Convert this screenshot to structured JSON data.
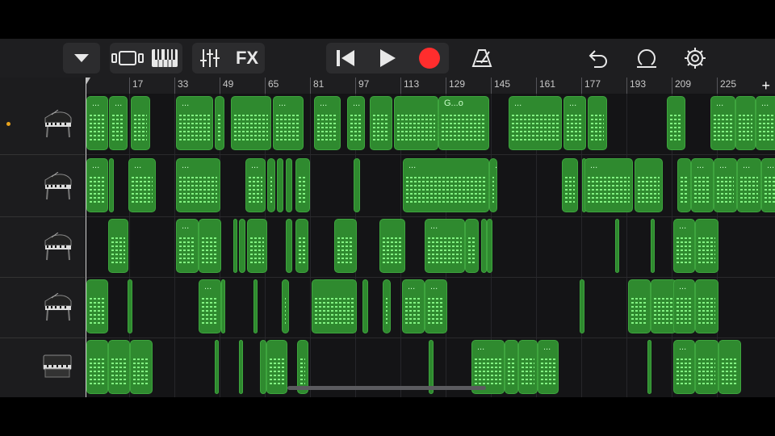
{
  "toolbar": {
    "buttons": [
      {
        "name": "tracks-dropdown-button",
        "icon": "triangle-down-icon"
      },
      {
        "name": "view-toggle-button",
        "icon": "tracks-view-icon"
      },
      {
        "name": "instrument-view-button",
        "icon": "keyboard-icon"
      },
      {
        "name": "mixer-button",
        "icon": "sliders-icon"
      },
      {
        "name": "fx-button",
        "label": "FX"
      },
      {
        "name": "go-to-start-button",
        "icon": "skip-back-icon"
      },
      {
        "name": "play-button",
        "icon": "play-icon"
      },
      {
        "name": "record-button",
        "icon": "record-icon",
        "color": "#ff2d2d"
      },
      {
        "name": "metronome-button",
        "icon": "metronome-icon"
      },
      {
        "name": "undo-button",
        "icon": "undo-icon"
      },
      {
        "name": "loop-browser-button",
        "icon": "loop-icon"
      },
      {
        "name": "settings-button",
        "icon": "gear-icon"
      }
    ],
    "fx_label": "FX"
  },
  "ruler": {
    "bars": [
      "17",
      "33",
      "49",
      "65",
      "81",
      "97",
      "113",
      "129",
      "145",
      "161",
      "177",
      "193",
      "209",
      "225"
    ],
    "add_label": "+"
  },
  "tracks": [
    {
      "instrument": "grand-piano-icon",
      "selected": true,
      "regions": [
        [
          "...",
          1,
          28
        ],
        [
          "...",
          29,
          52
        ],
        [
          "",
          56,
          80
        ],
        [
          "...",
          112,
          158
        ],
        [
          "",
          160,
          172
        ],
        [
          "",
          180,
          230
        ],
        [
          "...",
          232,
          270
        ],
        [
          "...",
          283,
          316
        ],
        [
          "...",
          324,
          346
        ],
        [
          "",
          352,
          380
        ],
        [
          "",
          382,
          437
        ],
        [
          "G...o",
          437,
          500
        ],
        [
          "...",
          524,
          590
        ],
        [
          "...",
          592,
          620
        ],
        [
          "",
          622,
          646
        ],
        [
          "",
          720,
          743
        ],
        [
          "...",
          774,
          805
        ],
        [
          "",
          805,
          830
        ],
        [
          "...",
          830,
          862
        ],
        [
          "",
          862,
          890
        ],
        [
          "...",
          890,
          918
        ],
        [
          "",
          918,
          945
        ]
      ]
    },
    {
      "instrument": "grand-piano-icon",
      "selected": false,
      "regions": [
        [
          "...",
          1,
          28
        ],
        [
          "",
          29,
          35
        ],
        [
          "...",
          53,
          87
        ],
        [
          "...",
          112,
          167
        ],
        [
          "...",
          198,
          223
        ],
        [
          "",
          225,
          235
        ],
        [
          "",
          237,
          245
        ],
        [
          "",
          248,
          256
        ],
        [
          "",
          260,
          278
        ],
        [
          "",
          332,
          340
        ],
        [
          "...",
          393,
          500
        ],
        [
          "...",
          500,
          510
        ],
        [
          "",
          590,
          610
        ],
        [
          "",
          615,
          620
        ],
        [
          "...",
          618,
          678
        ],
        [
          "",
          680,
          715
        ],
        [
          "",
          733,
          750
        ],
        [
          "...",
          750,
          778
        ],
        [
          "...",
          778,
          807
        ],
        [
          "...",
          807,
          837
        ],
        [
          "...",
          837,
          862
        ],
        [
          "...",
          862,
          890
        ],
        [
          "...",
          890,
          918
        ]
      ]
    },
    {
      "instrument": "grand-piano-icon",
      "selected": false,
      "regions": [
        [
          "",
          28,
          53
        ],
        [
          "...",
          112,
          140
        ],
        [
          "",
          140,
          168
        ],
        [
          "",
          183,
          187
        ],
        [
          "",
          190,
          198
        ],
        [
          "",
          200,
          225
        ],
        [
          "",
          248,
          256
        ],
        [
          "",
          260,
          276
        ],
        [
          "",
          308,
          336
        ],
        [
          "",
          364,
          396
        ],
        [
          "...",
          420,
          470
        ],
        [
          "",
          470,
          487
        ],
        [
          "",
          490,
          497
        ],
        [
          "",
          497,
          504
        ],
        [
          "",
          656,
          660
        ],
        [
          "",
          700,
          703
        ],
        [
          "...",
          728,
          755
        ],
        [
          "",
          755,
          784
        ]
      ]
    },
    {
      "instrument": "grand-piano-icon",
      "selected": false,
      "regions": [
        [
          "",
          1,
          28
        ],
        [
          "",
          52,
          58
        ],
        [
          "...",
          140,
          168
        ],
        [
          "",
          168,
          173
        ],
        [
          "",
          208,
          211
        ],
        [
          "",
          243,
          252
        ],
        [
          "",
          280,
          336
        ],
        [
          "",
          343,
          350
        ],
        [
          "",
          368,
          378
        ],
        [
          "...",
          392,
          420
        ],
        [
          "...",
          420,
          448
        ],
        [
          "",
          612,
          618
        ],
        [
          "",
          672,
          700
        ],
        [
          "",
          700,
          732
        ],
        [
          "...",
          728,
          755
        ],
        [
          "",
          755,
          784
        ]
      ]
    },
    {
      "instrument": "upright-piano-icon",
      "selected": false,
      "regions": [
        [
          "",
          1,
          28
        ],
        [
          "",
          28,
          55
        ],
        [
          "",
          55,
          83
        ],
        [
          "",
          160,
          165
        ],
        [
          "",
          190,
          195
        ],
        [
          "",
          216,
          224
        ],
        [
          "",
          224,
          250
        ],
        [
          "",
          262,
          276
        ],
        [
          "",
          425,
          431
        ],
        [
          "...",
          478,
          519
        ],
        [
          "",
          519,
          536
        ],
        [
          "",
          536,
          560
        ],
        [
          "...",
          560,
          586
        ],
        [
          "",
          696,
          700
        ],
        [
          "...",
          728,
          755
        ],
        [
          "",
          755,
          784
        ],
        [
          "",
          784,
          812
        ]
      ]
    }
  ]
}
